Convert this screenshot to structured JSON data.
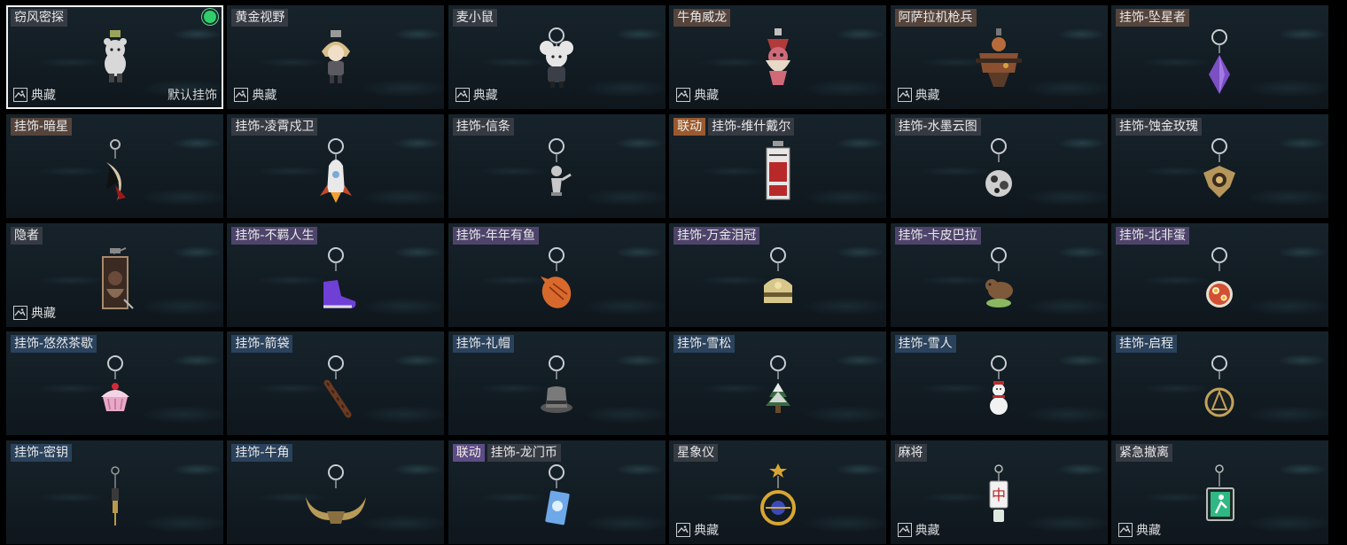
{
  "items": [
    {
      "tags": [
        {
          "text": "窃风密探",
          "tone": "gray"
        }
      ],
      "collection": "典藏",
      "default_label": "默认挂饰",
      "selected": true,
      "equipped": true,
      "icon": "bear-mascot-icon",
      "color": "#d8d8d8"
    },
    {
      "tags": [
        {
          "text": "黄金视野",
          "tone": "gray"
        }
      ],
      "collection": "典藏",
      "icon": "blond-doll-icon",
      "color": "#d9c08a"
    },
    {
      "tags": [
        {
          "text": "麦小鼠",
          "tone": "gray"
        }
      ],
      "collection": "典藏",
      "icon": "mouse-mascot-icon",
      "color": "#e6e6e6"
    },
    {
      "tags": [
        {
          "text": "牛角威龙",
          "tone": "brown"
        }
      ],
      "collection": "典藏",
      "icon": "dragon-figure-icon",
      "color": "#d06a78"
    },
    {
      "tags": [
        {
          "text": "阿萨拉机枪兵",
          "tone": "brown"
        }
      ],
      "collection": "典藏",
      "icon": "gunner-figure-icon",
      "color": "#8a5030"
    },
    {
      "tags": [
        {
          "text": "挂饰-坠星者",
          "tone": "brown"
        }
      ],
      "icon": "purple-crystal-icon",
      "color": "#7c4fc4"
    },
    {
      "tags": [
        {
          "text": "挂饰-暗星",
          "tone": "brown"
        }
      ],
      "icon": "crescent-pendant-icon",
      "color": "#d8c8a8"
    },
    {
      "tags": [
        {
          "text": "挂饰-凌霄戍卫",
          "tone": "gray"
        }
      ],
      "icon": "rocket-charm-icon",
      "color": "#e9e9e9"
    },
    {
      "tags": [
        {
          "text": "挂饰-信条",
          "tone": "gray"
        }
      ],
      "icon": "silver-figure-icon",
      "color": "#c8c8c8"
    },
    {
      "tags": [
        {
          "collab": "联动",
          "tone": "brown"
        },
        {
          "text": "挂饰-维什戴尔",
          "tone": "gray"
        }
      ],
      "icon": "red-card-icon",
      "color": "#b82a2a"
    },
    {
      "tags": [
        {
          "text": "挂饰-水墨云图",
          "tone": "gray"
        }
      ],
      "icon": "ink-ball-icon",
      "color": "#cfcfcf"
    },
    {
      "tags": [
        {
          "text": "挂饰-蚀金玫瑰",
          "tone": "gray"
        }
      ],
      "icon": "gold-rose-icon",
      "color": "#b6965a"
    },
    {
      "tags": [
        {
          "text": "隐者",
          "tone": "gray"
        }
      ],
      "collection": "典藏",
      "icon": "hermit-card-icon",
      "color": "#a88a6a"
    },
    {
      "tags": [
        {
          "text": "挂饰-不羁人生",
          "tone": "purple"
        }
      ],
      "icon": "purple-sneaker-icon",
      "color": "#6f3fd6"
    },
    {
      "tags": [
        {
          "text": "挂饰-年年有鱼",
          "tone": "purple"
        }
      ],
      "icon": "orange-fish-icon",
      "color": "#d8692c"
    },
    {
      "tags": [
        {
          "text": "挂饰-万金泪冠",
          "tone": "purple"
        }
      ],
      "icon": "gold-crown-icon",
      "color": "#d8c78a"
    },
    {
      "tags": [
        {
          "text": "挂饰-卡皮巴拉",
          "tone": "purple"
        }
      ],
      "icon": "capybara-icon",
      "color": "#7e5a3a"
    },
    {
      "tags": [
        {
          "text": "挂饰-北非蛋",
          "tone": "purple"
        }
      ],
      "icon": "shakshuka-icon",
      "color": "#d34f33"
    },
    {
      "tags": [
        {
          "text": "挂饰-悠然茶歇",
          "tone": "blue"
        }
      ],
      "icon": "cupcake-icon",
      "color": "#e8a8c8"
    },
    {
      "tags": [
        {
          "text": "挂饰-箭袋",
          "tone": "blue"
        }
      ],
      "icon": "quiver-icon",
      "color": "#6a3a22"
    },
    {
      "tags": [
        {
          "text": "挂饰-礼帽",
          "tone": "blue"
        }
      ],
      "icon": "top-hat-icon",
      "color": "#7a7a7a"
    },
    {
      "tags": [
        {
          "text": "挂饰-雪松",
          "tone": "blue"
        }
      ],
      "icon": "snow-tree-icon",
      "color": "#eaeaea"
    },
    {
      "tags": [
        {
          "text": "挂饰-雪人",
          "tone": "blue"
        }
      ],
      "icon": "snowman-icon",
      "color": "#f2f2f2"
    },
    {
      "tags": [
        {
          "text": "挂饰-启程",
          "tone": "blue"
        }
      ],
      "icon": "compass-emblem-icon",
      "color": "#c2a35a"
    },
    {
      "tags": [
        {
          "text": "挂饰-密钥",
          "tone": "blue"
        }
      ],
      "icon": "key-charm-icon",
      "color": "#b89a4a"
    },
    {
      "tags": [
        {
          "text": "挂饰-牛角",
          "tone": "blue"
        }
      ],
      "icon": "bull-horns-icon",
      "color": "#b89a58"
    },
    {
      "tags": [
        {
          "collab": "联动",
          "tone": "purple"
        },
        {
          "text": "挂饰-龙门币",
          "tone": "gray"
        }
      ],
      "icon": "blue-coin-card-icon",
      "color": "#6ea8e8"
    },
    {
      "tags": [
        {
          "text": "星象仪",
          "tone": "gray"
        }
      ],
      "collection": "典藏",
      "icon": "astrolabe-icon",
      "color": "#d9a632"
    },
    {
      "tags": [
        {
          "text": "麻将",
          "tone": "gray"
        }
      ],
      "collection": "典藏",
      "icon": "mahjong-tile-icon",
      "color": "#f2f2f2"
    },
    {
      "tags": [
        {
          "text": "紧急撤离",
          "tone": "gray"
        }
      ],
      "collection": "典藏",
      "icon": "exit-sign-icon",
      "color": "#2fb884"
    }
  ]
}
